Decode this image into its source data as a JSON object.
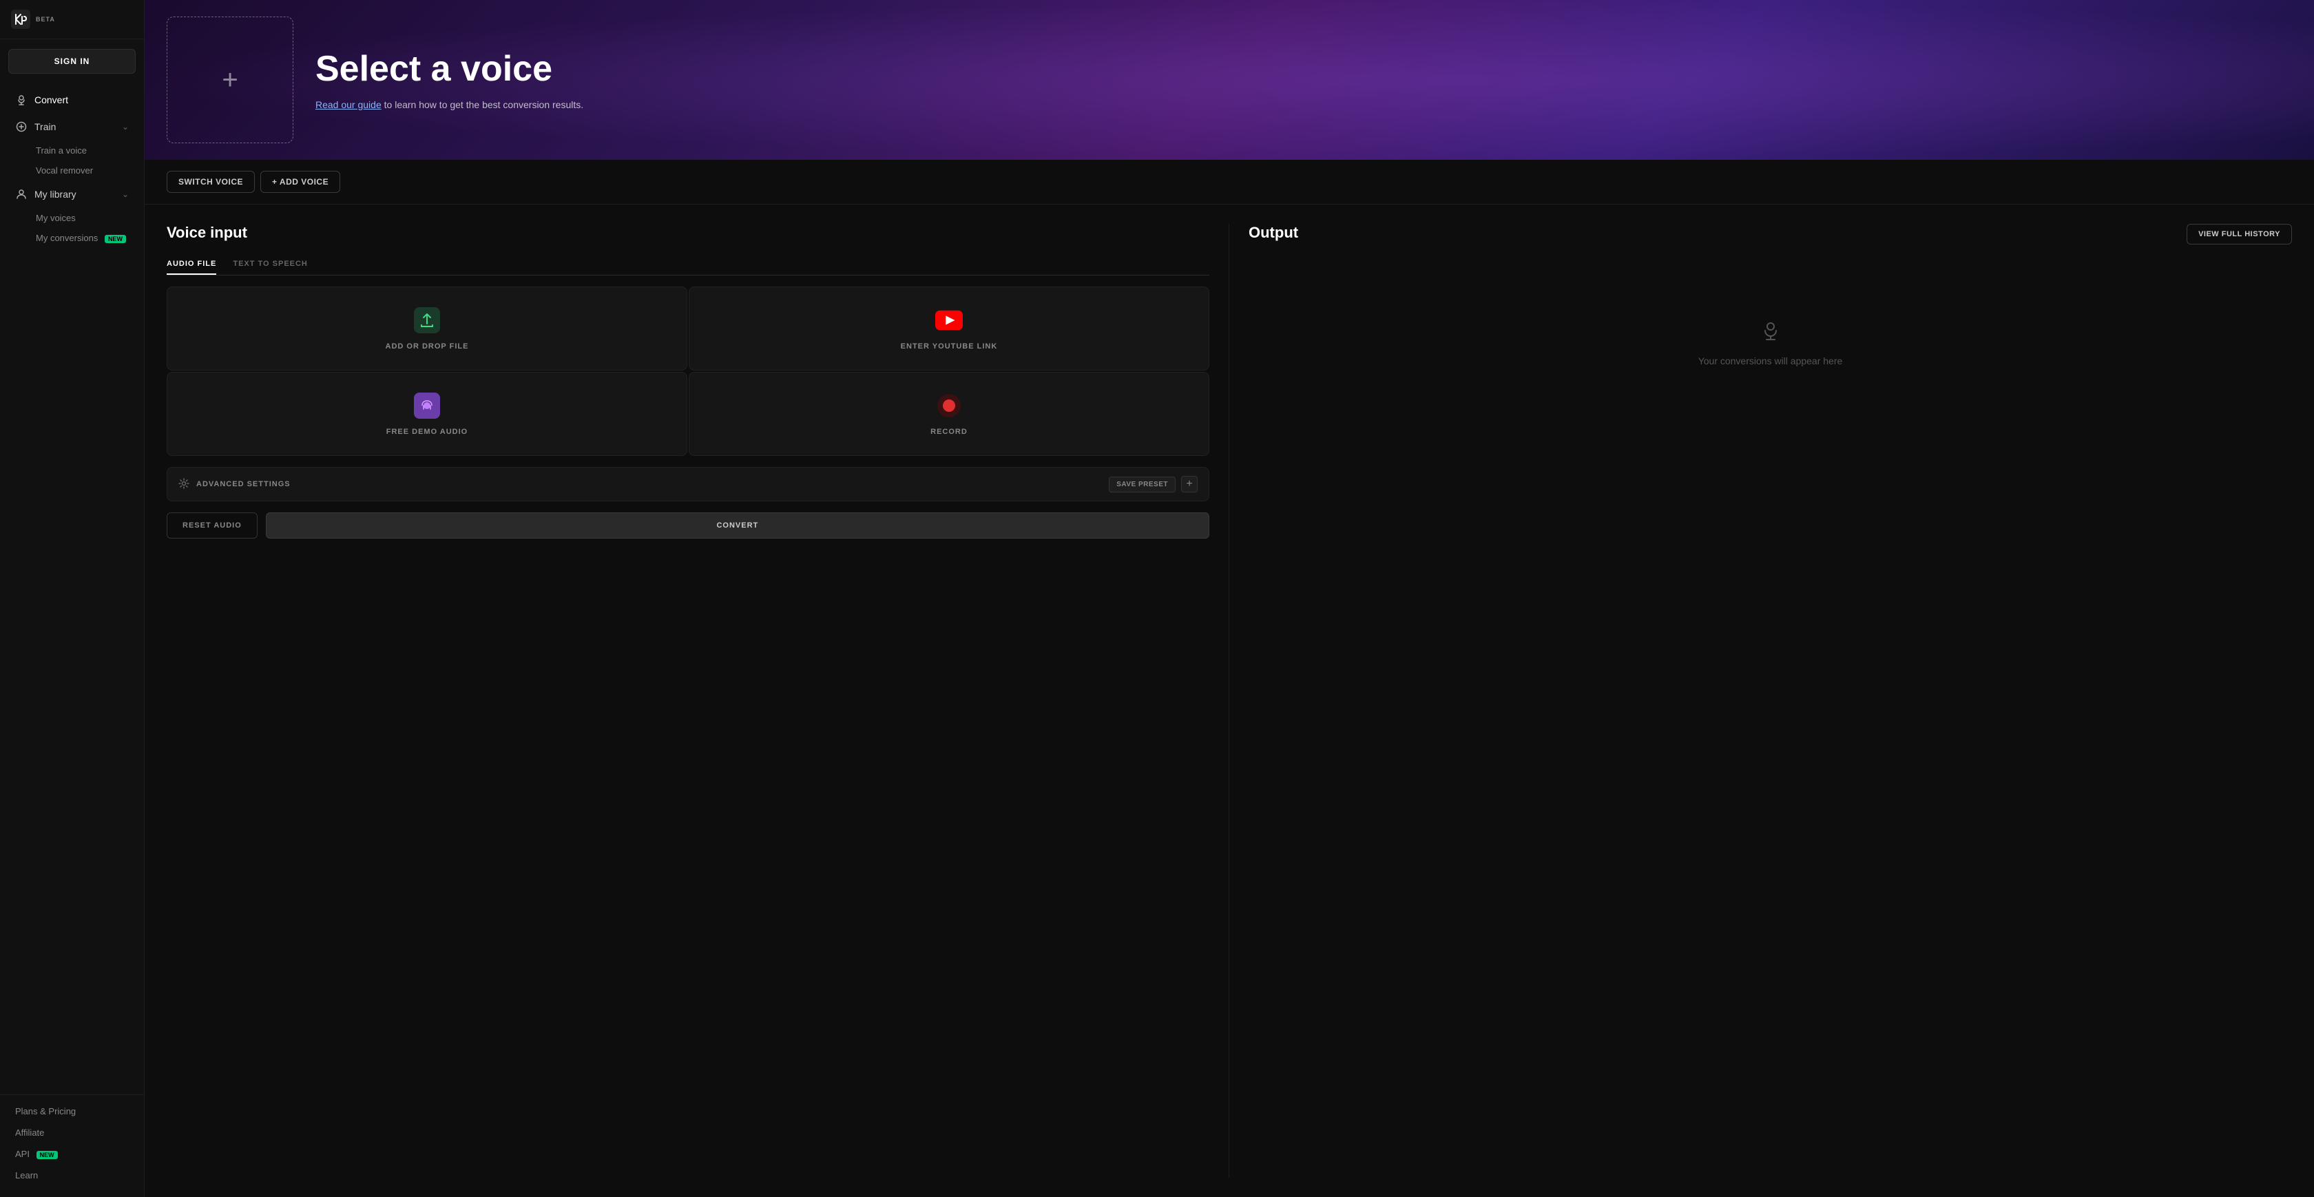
{
  "app": {
    "name": "Kits AI",
    "beta_label": "BETA"
  },
  "sidebar": {
    "sign_in_label": "SIGN IN",
    "nav_items": [
      {
        "id": "convert",
        "label": "Convert",
        "icon": "microphone",
        "active": true,
        "has_children": false
      },
      {
        "id": "train",
        "label": "Train",
        "icon": "plus",
        "active": false,
        "has_children": true
      }
    ],
    "train_children": [
      {
        "label": "Train a voice"
      },
      {
        "label": "Vocal remover"
      }
    ],
    "library_item": {
      "label": "My library",
      "icon": "person",
      "has_children": true
    },
    "library_children": [
      {
        "label": "My voices",
        "badge": null
      },
      {
        "label": "My conversions",
        "badge": "NEW"
      }
    ],
    "bottom_links": [
      {
        "label": "Plans & Pricing",
        "badge": null
      },
      {
        "label": "Affiliate",
        "badge": null
      },
      {
        "label": "API",
        "badge": "NEW"
      },
      {
        "label": "Learn",
        "badge": null
      }
    ]
  },
  "hero": {
    "title": "Select a voice",
    "subtitle_pre": "Read our guide",
    "subtitle_post": " to learn how to get the best conversion results.",
    "guide_link_text": "Read our guide",
    "voice_placeholder_label": "+"
  },
  "controls": {
    "switch_voice_label": "SWITCH VOICE",
    "add_voice_label": "+ ADD VOICE"
  },
  "voice_input": {
    "section_title": "Voice input",
    "tabs": [
      {
        "id": "audio-file",
        "label": "AUDIO FILE",
        "active": true
      },
      {
        "id": "text-to-speech",
        "label": "TEXT TO SPEECH",
        "active": false
      }
    ],
    "input_cards": [
      {
        "id": "add-drop",
        "label": "ADD OR DROP FILE",
        "icon_type": "upload"
      },
      {
        "id": "youtube",
        "label": "ENTER YOUTUBE LINK",
        "icon_type": "youtube"
      },
      {
        "id": "demo",
        "label": "FREE DEMO AUDIO",
        "icon_type": "demo"
      },
      {
        "id": "record",
        "label": "RECORD",
        "icon_type": "record"
      }
    ],
    "advanced_settings_label": "ADVANCED SETTINGS",
    "save_preset_label": "SAVE PRESET",
    "reset_label": "RESET AUDIO",
    "convert_label": "CONVERT"
  },
  "output": {
    "section_title": "Output",
    "view_history_label": "VIEW FULL HISTORY",
    "empty_text": "Your conversions will appear here"
  },
  "colors": {
    "accent_green": "#00c878",
    "sidebar_bg": "#111111",
    "main_bg": "#0d0d0d",
    "card_bg": "#161616",
    "border": "#222222"
  }
}
